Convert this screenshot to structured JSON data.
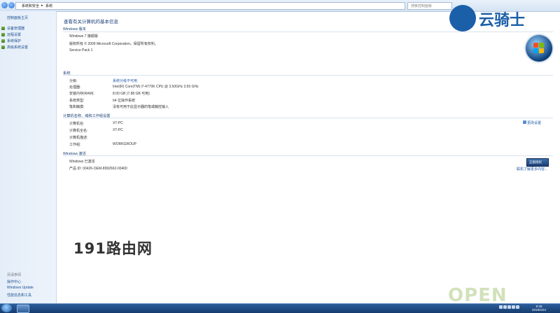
{
  "address_bar": {
    "crumb_1": "系统和安全",
    "crumb_sep": "▸",
    "crumb_2": "系统",
    "search_placeholder": "搜索控制面板"
  },
  "sidebar": {
    "home": "控制面板主页",
    "items": [
      {
        "label": "设备管理器"
      },
      {
        "label": "远程设置"
      },
      {
        "label": "系统保护"
      },
      {
        "label": "高级系统设置"
      }
    ],
    "see_also_heading": "另请参阅",
    "see_also": [
      {
        "label": "操作中心"
      },
      {
        "label": "Windows Update"
      },
      {
        "label": "性能信息和工具"
      }
    ]
  },
  "main": {
    "title": "查看有关计算机的基本信息",
    "edition": {
      "heading": "Windows 版本",
      "name": "Windows 7 旗舰版",
      "copyright": "版权所有 © 2009 Microsoft Corporation。保留所有权利。",
      "service_pack": "Service Pack 1"
    },
    "system": {
      "heading": "系统",
      "rows": [
        {
          "label": "分级:",
          "value": "系统分级不可用"
        },
        {
          "label": "处理器:",
          "value": "Intel(R) Core(TM) i7-4770K CPU @ 3.50GHz   3.50 GHz"
        },
        {
          "label": "安装内存(RAM):",
          "value": "8.00 GB (7.88 GB 可用)"
        },
        {
          "label": "系统类型:",
          "value": "64 位操作系统"
        },
        {
          "label": "笔和触摸:",
          "value": "没有可用于此显示器的笔或触控输入"
        }
      ]
    },
    "computer": {
      "heading": "计算机名称、域和工作组设置",
      "change_settings": "更改设置",
      "rows": [
        {
          "label": "计算机名:",
          "value": "XT-PC"
        },
        {
          "label": "计算机全名:",
          "value": "XT-PC"
        },
        {
          "label": "计算机描述:",
          "value": ""
        },
        {
          "label": "工作组:",
          "value": "WORKGROUP"
        }
      ]
    },
    "activation": {
      "heading": "Windows 激活",
      "status": "Windows 已激活",
      "product_id": "产品 ID: 00426-OEM-8992662-00400",
      "genuine_link": "联机了解更多内容...",
      "badge_text": "正版授权"
    }
  },
  "overlays": {
    "watermark_191": "191路由网",
    "logo_text": "云骑士",
    "open_watermark": "OPEN"
  },
  "taskbar": {
    "time": "9:28",
    "date": "2019/4/24"
  }
}
